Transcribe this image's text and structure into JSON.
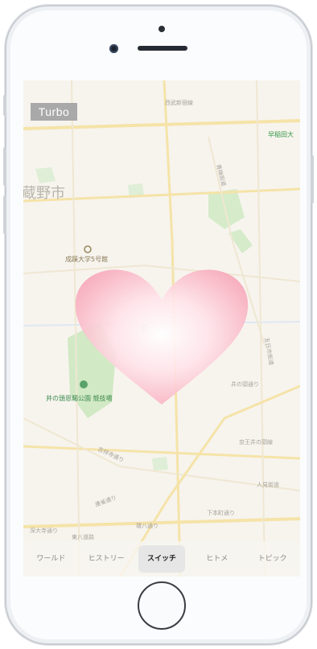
{
  "overlay": {
    "turbo_label": "Turbo"
  },
  "map": {
    "city_label": "蔵野市",
    "labels": {
      "university": "成蹊大学5号館",
      "park": "井の頭恩賜公園 競技場",
      "station_area": "早稲田大",
      "road_1": "西武新宿線",
      "road_2": "青梅街道",
      "road_3": "五日市街道",
      "road_4": "井の頭通り",
      "road_5": "人見街道",
      "road_6": "東八道路",
      "road_7": "連雀通り",
      "road_8": "環八通り",
      "road_9": "京王井の頭線",
      "road_10": "吉祥寺通り",
      "road_11": "下本町通り",
      "road_12": "深大寺通り"
    }
  },
  "tabs": [
    {
      "label": "ワールド",
      "active": false
    },
    {
      "label": "ヒストリー",
      "active": false
    },
    {
      "label": "スイッチ",
      "active": true
    },
    {
      "label": "ヒトメ",
      "active": false
    },
    {
      "label": "トピック",
      "active": false
    }
  ],
  "colors": {
    "heart_outer": "#f7a6b8",
    "heart_inner": "#ffffff",
    "map_bg": "#f7f4ee",
    "park_green": "#cde8c0",
    "road_yellow": "#f5e3a8"
  },
  "icons": [
    "heart-icon",
    "university-pin-icon",
    "park-pin-icon",
    "home-button-icon",
    "camera-icon"
  ]
}
